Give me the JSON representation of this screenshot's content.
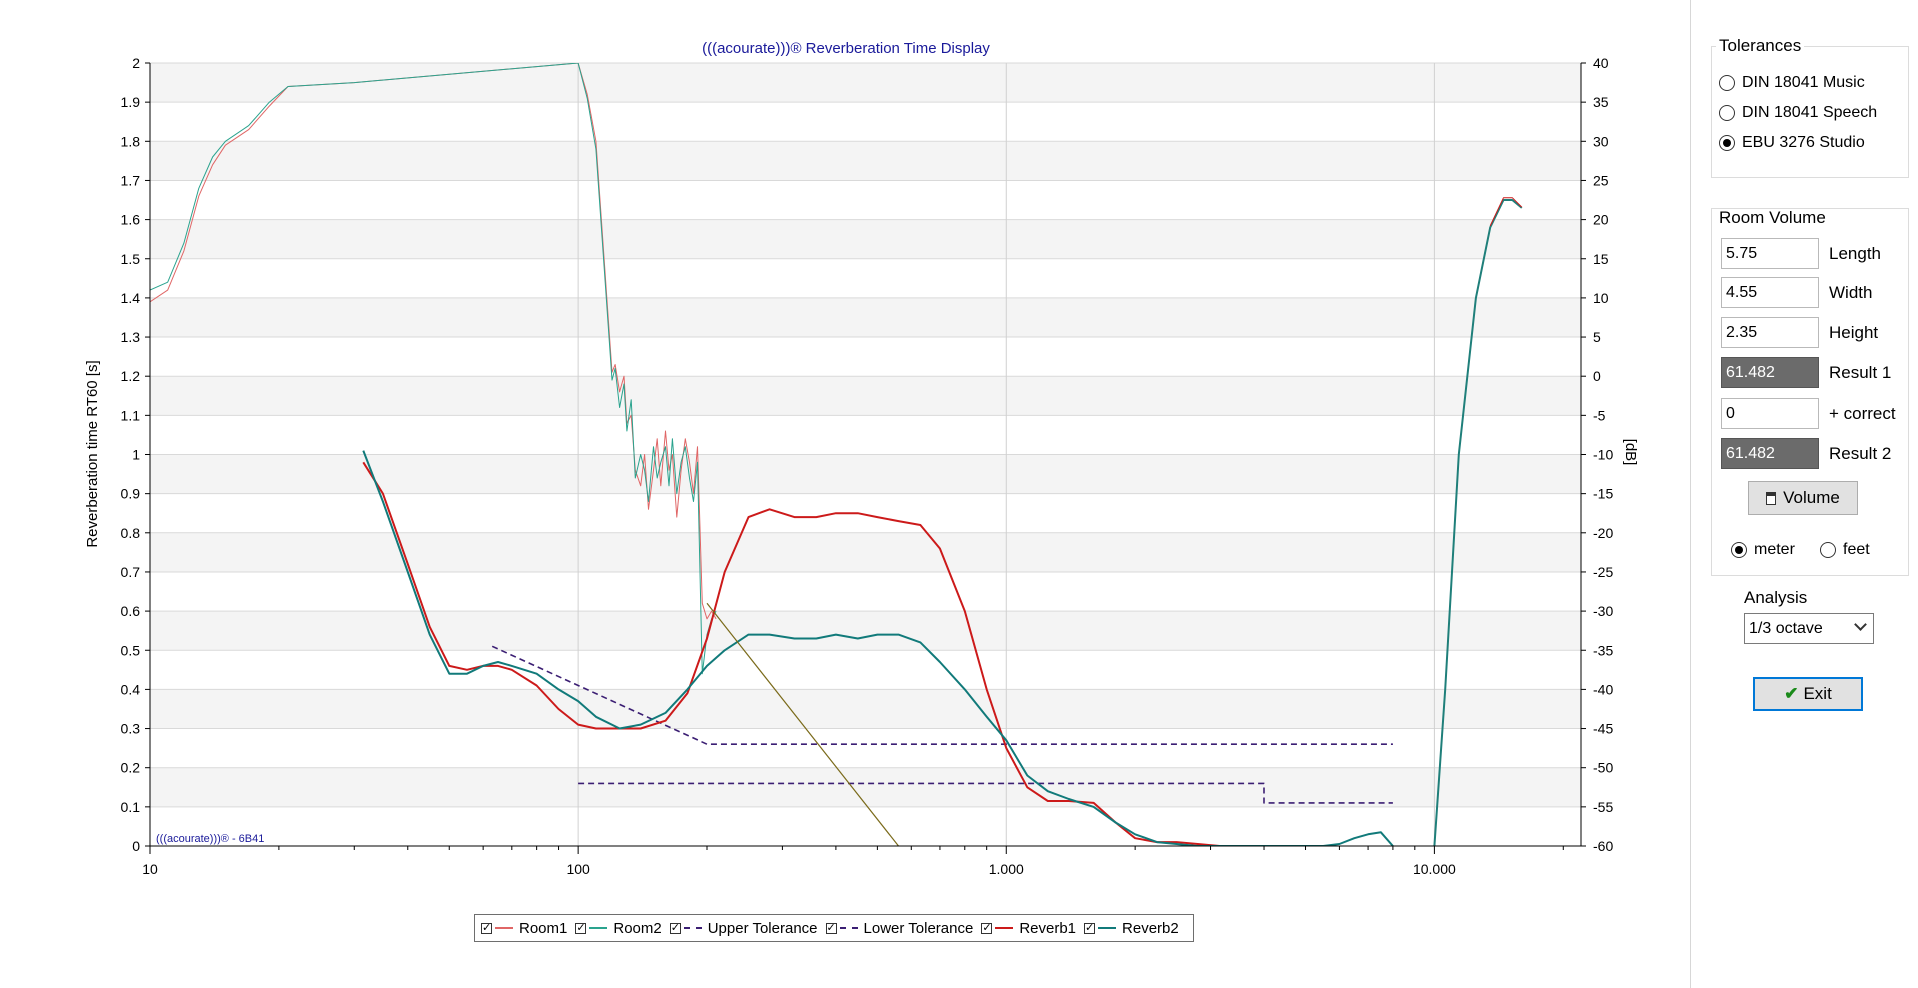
{
  "chart_data": {
    "type": "line",
    "title": "(((acourate)))® Reverberation Time Display",
    "ylabel": "Reverberation time RT60 [s]",
    "y2label": "[dB]",
    "xscale": "log",
    "xlim": [
      10,
      22000
    ],
    "ylim": [
      0,
      2
    ],
    "y2lim": [
      -60,
      40
    ],
    "grid": true,
    "legend_position": "bottom",
    "watermark": "(((acourate)))® - 6B41",
    "x_ticks": [
      {
        "value": 10,
        "label": "10"
      },
      {
        "value": 100,
        "label": "100"
      },
      {
        "value": 1000,
        "label": "1.000"
      },
      {
        "value": 10000,
        "label": "10.000"
      }
    ],
    "y_ticks": [
      "0",
      "0.1",
      "0.2",
      "0.3",
      "0.4",
      "0.5",
      "0.6",
      "0.7",
      "0.8",
      "0.9",
      "1",
      "1.1",
      "1.2",
      "1.3",
      "1.4",
      "1.5",
      "1.6",
      "1.7",
      "1.8",
      "1.9",
      "2"
    ],
    "y2_ticks": [
      "-60",
      "-55",
      "-50",
      "-45",
      "-40",
      "-35",
      "-30",
      "-25",
      "-20",
      "-15",
      "-10",
      "-5",
      "0",
      "5",
      "10",
      "15",
      "20",
      "25",
      "30",
      "35",
      "40"
    ],
    "series": [
      {
        "name": "Room1",
        "axis": "y2",
        "color": "#e06666",
        "width": 1,
        "dash": "",
        "x": [
          10,
          11,
          12,
          13,
          14,
          15,
          17,
          19,
          21,
          30,
          100,
          105,
          110,
          115,
          120,
          122,
          125,
          128,
          130,
          133,
          136,
          140,
          143,
          146,
          150,
          153,
          156,
          160,
          163,
          166,
          170,
          174,
          178,
          182,
          186,
          190,
          195,
          200,
          205,
          210
        ],
        "y": [
          9.5,
          11,
          16,
          23,
          27,
          29.5,
          31.5,
          34.5,
          37,
          37.5,
          40,
          36,
          30,
          15,
          0.5,
          1.5,
          -2,
          0,
          -6,
          -5,
          -12,
          -14,
          -10,
          -17,
          -12,
          -8,
          -14,
          -7,
          -12,
          -10,
          -18,
          -12,
          -8,
          -11,
          -15,
          -9,
          -29,
          -31,
          -30,
          -31
        ]
      },
      {
        "name": "Room2",
        "axis": "y2",
        "color": "#2aa38e",
        "width": 1,
        "dash": "",
        "x": [
          10,
          11,
          12,
          13,
          14,
          15,
          17,
          19,
          21,
          30,
          100,
          105,
          110,
          115,
          120,
          122,
          125,
          128,
          130,
          133,
          136,
          140,
          143,
          146,
          150,
          153,
          156,
          160,
          163,
          166,
          170,
          174,
          178,
          182,
          186,
          190,
          195,
          200,
          205,
          210
        ],
        "y": [
          11,
          12,
          17,
          24,
          28,
          30,
          32,
          35,
          37,
          37.5,
          40,
          35.5,
          29,
          14,
          -0.5,
          1,
          -4,
          -1,
          -7,
          -3,
          -13,
          -10,
          -12,
          -16,
          -9,
          -13,
          -11,
          -9,
          -14,
          -8,
          -15,
          -11,
          -9,
          -13,
          -16,
          -11,
          -38,
          -33,
          -31,
          -30
        ]
      },
      {
        "name": "Upper Tolerance",
        "axis": "y",
        "color": "#3b1e73",
        "width": 1.6,
        "dash": "6,4",
        "x": [
          63,
          200,
          8000
        ],
        "y": [
          0.51,
          0.26,
          0.26
        ]
      },
      {
        "name": "Lower Tolerance",
        "axis": "y",
        "color": "#3b1e73",
        "width": 1.6,
        "dash": "6,4",
        "x": [
          100,
          4000,
          4000,
          8000
        ],
        "y": [
          0.16,
          0.16,
          0.11,
          0.11
        ]
      },
      {
        "name": "Reverb1",
        "axis": "y",
        "color": "#cc1a1a",
        "width": 2,
        "dash": "",
        "x": [
          31.5,
          35,
          40,
          45,
          50,
          55,
          60,
          65,
          70,
          80,
          90,
          100,
          110,
          125,
          140,
          160,
          180,
          200,
          220,
          250,
          280,
          320,
          360,
          400,
          450,
          500,
          560,
          630,
          700,
          800,
          900,
          1000,
          1120,
          1250,
          1400,
          1600,
          1800,
          2000,
          2250,
          2500,
          2800,
          3150,
          3600,
          4000
        ],
        "y": [
          0.98,
          0.9,
          0.72,
          0.56,
          0.46,
          0.45,
          0.46,
          0.46,
          0.45,
          0.41,
          0.35,
          0.31,
          0.3,
          0.3,
          0.3,
          0.32,
          0.39,
          0.53,
          0.7,
          0.84,
          0.86,
          0.84,
          0.84,
          0.85,
          0.85,
          0.84,
          0.83,
          0.82,
          0.76,
          0.6,
          0.4,
          0.25,
          0.15,
          0.115,
          0.115,
          0.11,
          0.06,
          0.02,
          0.01,
          0.01,
          0.005,
          0.0,
          0.0,
          0.0
        ]
      },
      {
        "name": "Reverb2",
        "axis": "y",
        "color": "#117a7a",
        "width": 2,
        "dash": "",
        "x": [
          31.5,
          35,
          40,
          45,
          50,
          55,
          60,
          65,
          70,
          80,
          90,
          100,
          110,
          125,
          140,
          160,
          180,
          200,
          220,
          250,
          280,
          320,
          360,
          400,
          450,
          500,
          560,
          630,
          700,
          800,
          900,
          1000,
          1120,
          1250,
          1400,
          1600,
          1800,
          2000,
          2250,
          2500,
          2800,
          3150,
          3600,
          4000,
          4500,
          5000,
          5500,
          6000,
          6500,
          7000,
          7500,
          8000
        ],
        "y": [
          1.01,
          0.88,
          0.7,
          0.54,
          0.44,
          0.44,
          0.46,
          0.47,
          0.46,
          0.44,
          0.4,
          0.37,
          0.33,
          0.3,
          0.31,
          0.34,
          0.4,
          0.46,
          0.5,
          0.54,
          0.54,
          0.53,
          0.53,
          0.54,
          0.53,
          0.54,
          0.54,
          0.52,
          0.47,
          0.4,
          0.33,
          0.27,
          0.18,
          0.14,
          0.12,
          0.1,
          0.06,
          0.03,
          0.01,
          0.005,
          0.0,
          0.0,
          0.0,
          0.0,
          0.0,
          0.0,
          0.0,
          0.005,
          0.02,
          0.03,
          0.035,
          0.0
        ]
      },
      {
        "name": "",
        "axis": "y2",
        "color": "#7a6a1a",
        "width": 1.2,
        "dash": "",
        "x": [
          200,
          560
        ],
        "y": [
          -29,
          -60
        ]
      },
      {
        "name": "",
        "axis": "y2",
        "color": "#1f7f7a",
        "width": 2,
        "dash": "",
        "x": [
          10000,
          10600,
          11400,
          12500,
          13500,
          14500,
          15200,
          16000
        ],
        "y": [
          -60,
          -40,
          -10,
          10,
          19,
          22.5,
          22.5,
          21.5
        ]
      },
      {
        "name": "",
        "axis": "y2",
        "color": "#cc1a1a",
        "width": 1,
        "dash": "",
        "x": [
          13500,
          14500,
          15200,
          16000
        ],
        "y": [
          19.2,
          22.8,
          22.8,
          21.6
        ]
      }
    ]
  },
  "legend": {
    "items": [
      {
        "label": "Room1",
        "color": "#e06666",
        "dash": false
      },
      {
        "label": "Room2",
        "color": "#2aa38e",
        "dash": false
      },
      {
        "label": "Upper Tolerance",
        "color": "#3b1e73",
        "dash": true
      },
      {
        "label": "Lower Tolerance",
        "color": "#3b1e73",
        "dash": true
      },
      {
        "label": "Reverb1",
        "color": "#cc1a1a",
        "dash": false
      },
      {
        "label": "Reverb2",
        "color": "#117a7a",
        "dash": false
      }
    ]
  },
  "panel": {
    "tolerances": {
      "title": "Tolerances",
      "options": [
        {
          "label": "DIN 18041 Music",
          "checked": false
        },
        {
          "label": "DIN 18041 Speech",
          "checked": false
        },
        {
          "label": "EBU 3276 Studio",
          "checked": true
        }
      ]
    },
    "room_volume": {
      "title": "Room Volume",
      "length_value": "5.75",
      "length_label": "Length",
      "width_value": "4.55",
      "width_label": "Width",
      "height_value": "2.35",
      "height_label": "Height",
      "result1_value": "61.482",
      "result1_label": "Result 1",
      "correct_value": "0",
      "correct_label": "+ correct",
      "result2_value": "61.482",
      "result2_label": "Result 2",
      "volume_button": "Volume",
      "unit_meter": "meter",
      "unit_feet": "feet",
      "meter_checked": true
    },
    "analysis": {
      "label": "Analysis",
      "selected": "1/3 octave"
    },
    "exit_button": "Exit"
  }
}
